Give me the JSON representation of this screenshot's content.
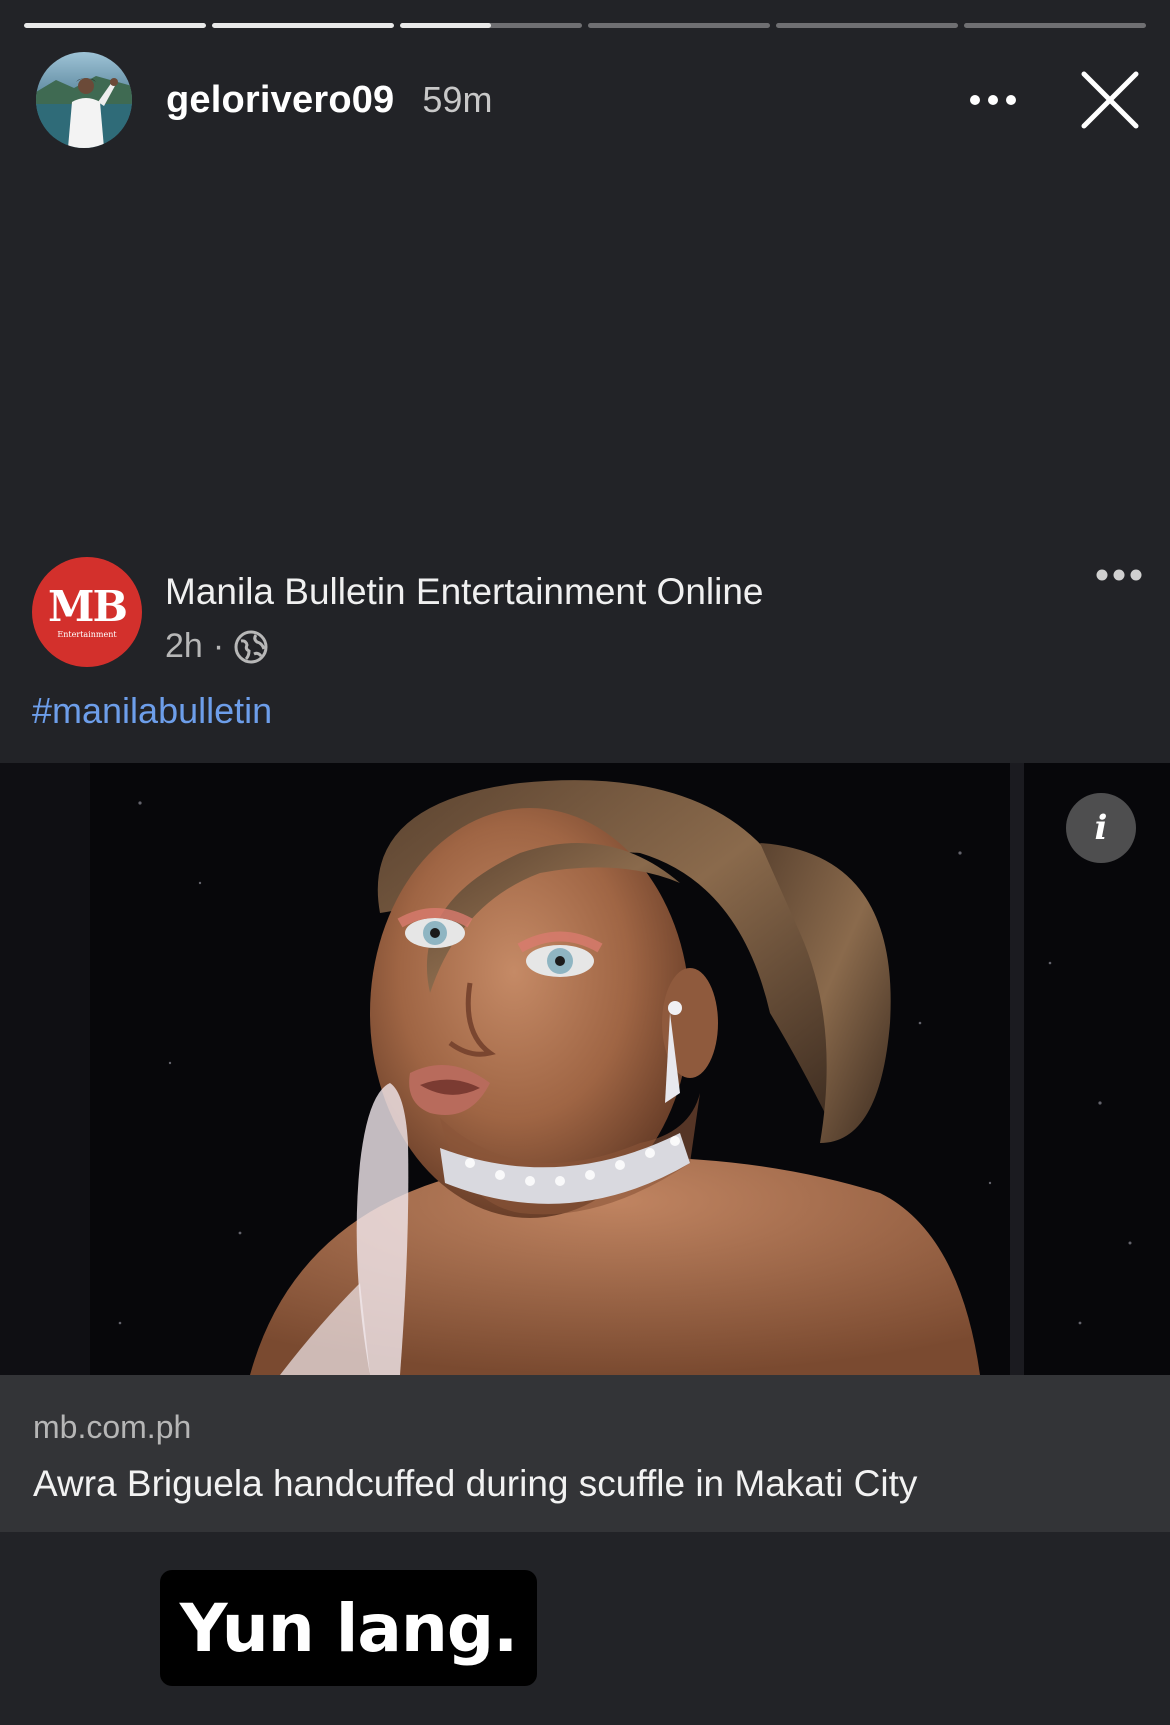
{
  "story": {
    "progress": [
      1.0,
      1.0,
      0.5,
      0.0,
      0.0,
      0.0
    ],
    "username": "gelorivero09",
    "time": "59m",
    "avatar_icon": "profile-photo-avatar",
    "more_icon": "more-horizontal-icon",
    "close_icon": "close-x-icon"
  },
  "post": {
    "page_name": "Manila Bulletin Entertainment Online",
    "logo_text": "MB",
    "logo_subtext": "Entertainment",
    "logo_color": "#d3302c",
    "time": "2h",
    "separator": "·",
    "privacy_icon": "globe-icon",
    "hashtag": "#manilabulletin",
    "info_label": "i",
    "link": {
      "domain": "mb.com.ph",
      "title": "Awra Briguela handcuffed during scuffle in Makati City"
    }
  },
  "caption": {
    "text": "Yun lang."
  },
  "colors": {
    "background": "#222327",
    "hashtag": "#6d9eea",
    "link_box": "#333437"
  }
}
